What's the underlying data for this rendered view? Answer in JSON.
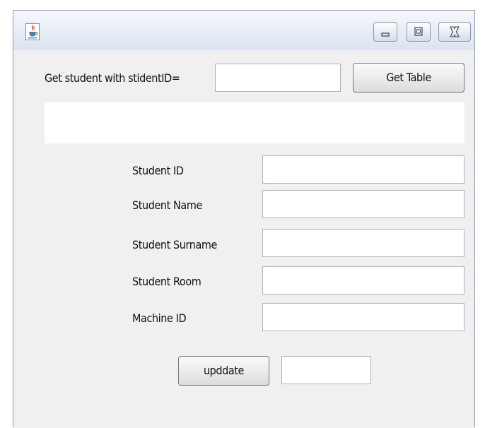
{
  "window": {
    "title": "",
    "icon": "java-cup-icon",
    "controls": {
      "minimize_icon": "minimize-icon",
      "maximize_icon": "maximize-icon",
      "close_icon": "close-icon"
    }
  },
  "query": {
    "label": "Get student with stidentID=",
    "student_id_value": "",
    "get_table_label": "Get Table"
  },
  "results": {
    "text": ""
  },
  "form": {
    "student_id_label": "Student ID",
    "student_id_value": "",
    "student_name_label": "Student Name",
    "student_name_value": "",
    "student_surname_label": "Student Surname",
    "student_surname_value": "",
    "student_room_label": "Student Room",
    "student_room_value": "",
    "machine_id_label": "Machine ID",
    "machine_id_value": ""
  },
  "footer": {
    "update_label": "upddate",
    "status_value": ""
  },
  "colors": {
    "window_bg": "#f0f0f0",
    "titlebar_top": "#f7f9fc",
    "titlebar_bottom": "#dbe4ef",
    "field_border": "#a9b3bd"
  }
}
